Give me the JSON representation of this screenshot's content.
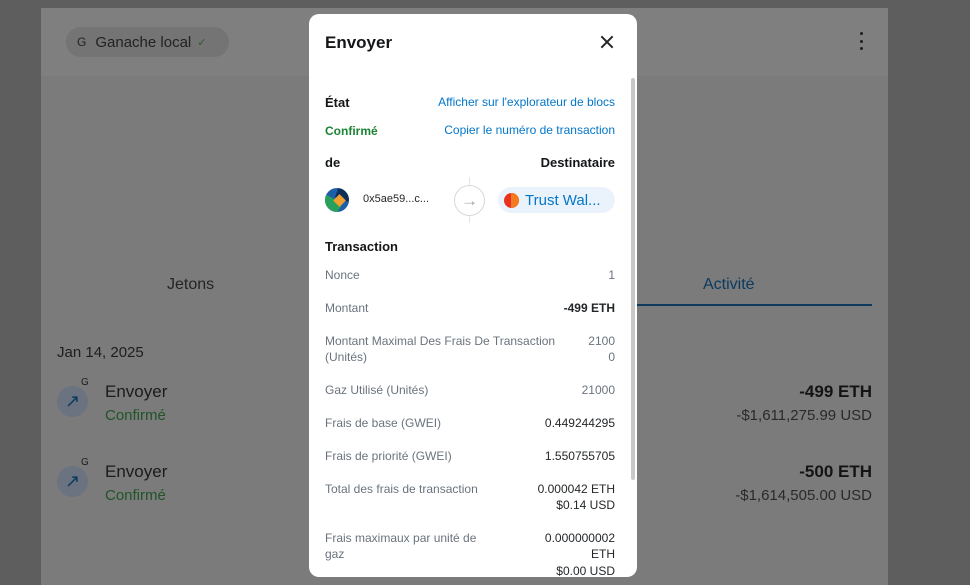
{
  "background": {
    "network": {
      "letter": "G",
      "name": "Ganache local"
    },
    "tabs": {
      "tokens": "Jetons",
      "activity": "Activité"
    },
    "date": "Jan 14, 2025",
    "transactions": [
      {
        "badge": "G",
        "title": "Envoyer",
        "status": "Confirmé",
        "amount": "-499 ETH",
        "fiat": "-$1,611,275.99 USD"
      },
      {
        "badge": "G",
        "title": "Envoyer",
        "status": "Confirmé",
        "amount": "-500 ETH",
        "fiat": "-$1,614,505.00 USD"
      }
    ]
  },
  "modal": {
    "title": "Envoyer",
    "status_label": "État",
    "status_value": "Confirmé",
    "explorer_link": "Afficher sur l'explorateur de blocs",
    "copy_link": "Copier le numéro de transaction",
    "from_label": "de",
    "to_label": "Destinataire",
    "from_address": "0x5ae59...c...",
    "recipient_name": "Trust Wal...",
    "section_title": "Transaction",
    "rows": {
      "nonce": {
        "label": "Nonce",
        "value": "1"
      },
      "amount": {
        "label": "Montant",
        "value": "-499 ETH"
      },
      "max_fee": {
        "label_1": "Montant Maximal Des Frais De Transaction",
        "label_2": "(Unités)",
        "value_1": "2100",
        "value_2": "0"
      },
      "gas_used": {
        "label": "Gaz Utilisé (Unités)",
        "value": "21000"
      },
      "base_fee": {
        "label": "Frais de base (GWEI)",
        "value": "0.449244295"
      },
      "priority_fee": {
        "label": "Frais de priorité (GWEI)",
        "value": "1.550755705"
      },
      "total_fee": {
        "label": "Total des frais de transaction",
        "value_1": "0.000042 ETH",
        "value_2": "$0.14 USD"
      },
      "max_per_gas": {
        "label_1": "Frais maximaux par unité de",
        "label_2": "gaz",
        "value_1": "0.000000002",
        "value_2": "ETH",
        "value_3": "$0.00 USD"
      }
    }
  },
  "colors": {
    "link": "#0376c9",
    "success": "#1c8234",
    "overlay": "#5e5e5e",
    "active_tab": "#0b3a5e"
  }
}
